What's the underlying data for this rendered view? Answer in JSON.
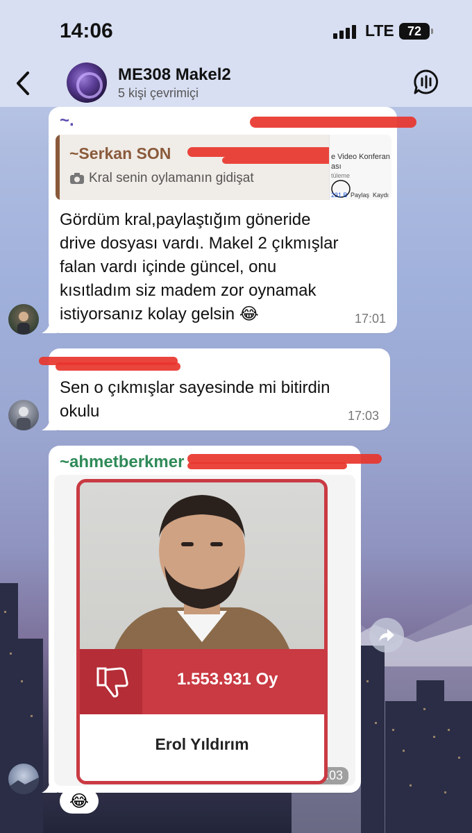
{
  "status_bar": {
    "time": "14:06",
    "network": "LTE",
    "battery": "72"
  },
  "header": {
    "title": "ME308 Makel2",
    "subtitle": "5 kişi çevrimiçi",
    "back_icon": "chevron-left-icon",
    "voice_chat_icon": "voice-chat-icon"
  },
  "messages": [
    {
      "sender": "~.",
      "reply": {
        "name": "~Serkan SON",
        "snippet": "Kral senin oylamanın gidişat",
        "snippet_icon": "camera-icon",
        "thumb_title": "e Video Konferan",
        "thumb_line2": "ası",
        "thumb_line3": "tüleme",
        "thumb_count": "231 B",
        "thumb_share": "Paylaş",
        "thumb_save": "Kaydı"
      },
      "lines": [
        "Gördüm kral,paylaştığım göneride",
        "drive dosyası vardı. Makel 2 çıkmışlar",
        "falan vardı içinde güncel, onu",
        "kısıtladım siz madem zor oynamak",
        "istiyorsanız kolay gelsin 😂"
      ],
      "time": "17:01"
    },
    {
      "lines": [
        "Sen o çıkmışlar sayesinde mi bitirdin",
        "okulu"
      ],
      "time": "17:03"
    },
    {
      "sender": "~ahmetberkmer",
      "image_card": {
        "votes": "1.553.931 Oy",
        "candidate": "Erol Yıldırım",
        "thumb_icon": "thumbs-down-icon"
      },
      "time": "17:03",
      "reaction": "😂"
    }
  ],
  "colors": {
    "sender_1": "#5b4fb0",
    "sender_reply": "#8a5a3b",
    "sender_3": "#2f8a58",
    "card_red": "#c93a43"
  }
}
